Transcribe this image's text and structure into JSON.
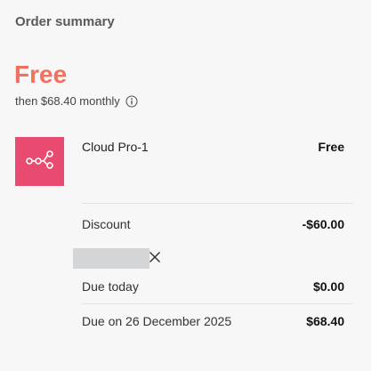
{
  "summary": {
    "heading": "Order summary",
    "price_big": "Free",
    "price_sub": "then $68.40 monthly"
  },
  "product": {
    "name": "Cloud Pro-1",
    "price": "Free",
    "icon": "workflow-nodes-icon",
    "tile_color": "#e84a70"
  },
  "lines": {
    "discount": {
      "label": "Discount",
      "value": "-$60.00"
    },
    "due_today": {
      "label": "Due today",
      "value": "$0.00"
    },
    "due_later": {
      "label": "Due on 26 December 2025",
      "value": "$68.40"
    }
  },
  "colors": {
    "accent": "#f0715f",
    "panel_bg": "#f7f7f7"
  }
}
